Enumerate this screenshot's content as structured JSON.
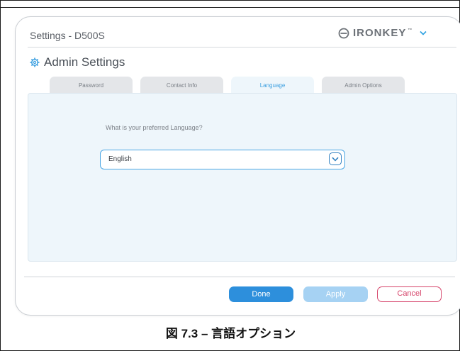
{
  "window": {
    "title": "Settings - D500S",
    "brand": "IRONKEY",
    "brand_mark": "™",
    "brand_dropdown_icon": "chevron-down-icon"
  },
  "page": {
    "heading": "Admin Settings",
    "heading_icon": "gear-icon"
  },
  "tabs": [
    {
      "label": "Password",
      "active": false
    },
    {
      "label": "Contact Info",
      "active": false
    },
    {
      "label": "Language",
      "active": true
    },
    {
      "label": "Admin Options",
      "active": false
    }
  ],
  "language": {
    "question": "What is your preferred Language?",
    "selected": "English",
    "dropdown_icon": "chevron-down-icon"
  },
  "buttons": {
    "done": "Done",
    "apply": "Apply",
    "cancel": "Cancel"
  },
  "caption": "図 7.3 – 言語オプション",
  "colors": {
    "accent": "#2d8fdc",
    "accent_disabled": "#a6d2f3",
    "cancel": "#d6456b",
    "panel_bg": "#eef6fb"
  }
}
